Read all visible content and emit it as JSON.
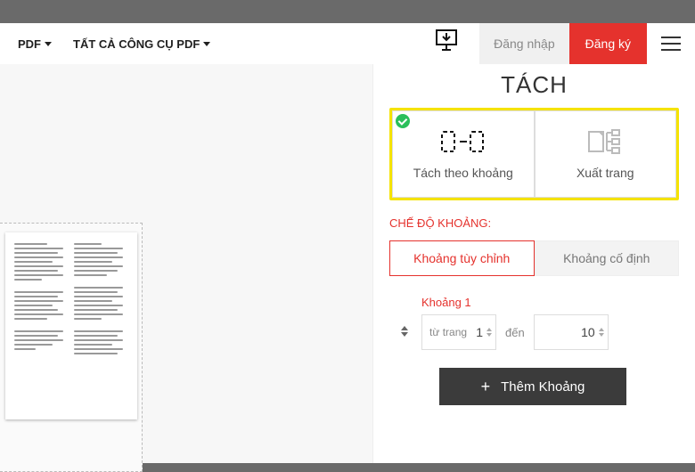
{
  "nav": {
    "item1": "PDF",
    "item2": "TẤT CẢ CÔNG CỤ PDF",
    "login": "Đăng nhập",
    "signup": "Đăng ký"
  },
  "panel": {
    "title": "TÁCH",
    "mode_range": "Tách theo khoảng",
    "mode_extract": "Xuất trang",
    "section_label": "CHẾ ĐỘ KHOẢNG:",
    "tab_custom": "Khoảng tùy chỉnh",
    "tab_fixed": "Khoảng cố định",
    "range1_title": "Khoảng 1",
    "from_label": "từ trang",
    "from_value": "1",
    "to_label": "đến",
    "to_value": "10",
    "add_range": "Thêm Khoảng"
  }
}
